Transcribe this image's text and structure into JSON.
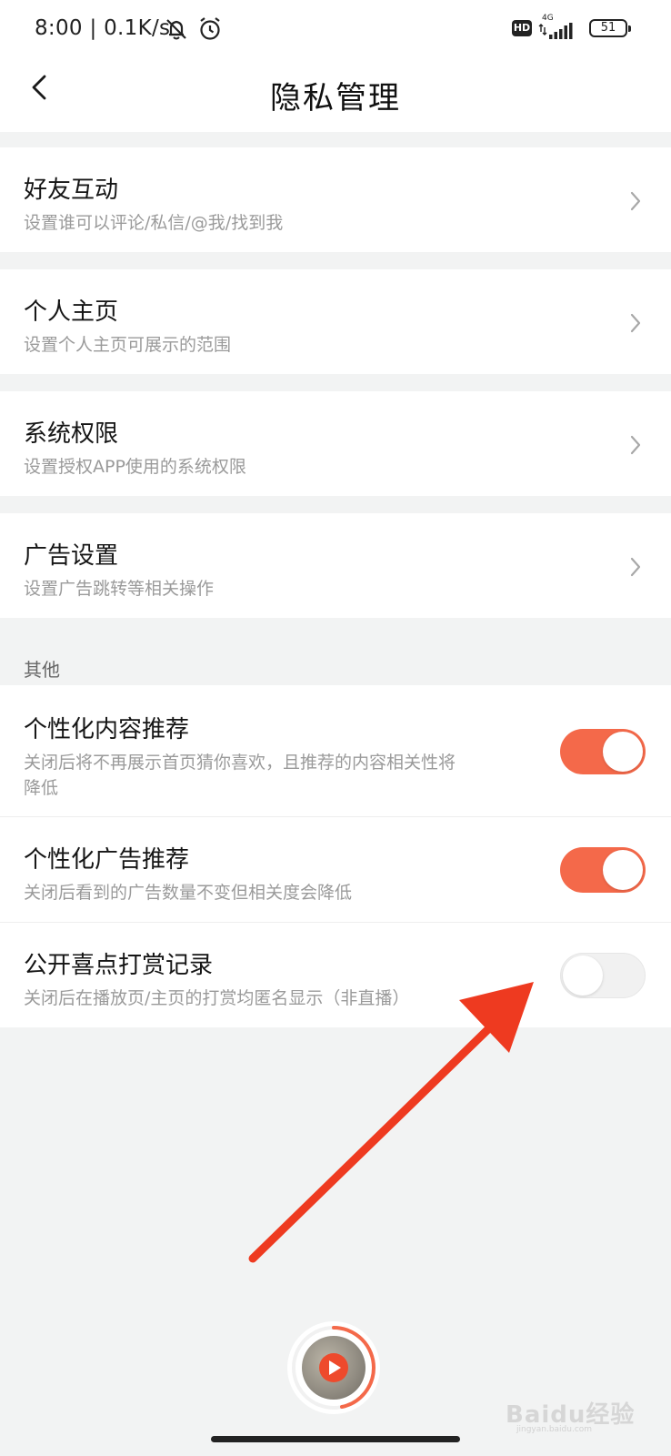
{
  "status_bar": {
    "time": "8:00 | 0.1K/s",
    "hd_label": "HD",
    "network_label": "4G",
    "battery": "51"
  },
  "header": {
    "title": "隐私管理"
  },
  "menu": [
    {
      "title": "好友互动",
      "subtitle": "设置谁可以评论/私信/@我/找到我"
    },
    {
      "title": "个人主页",
      "subtitle": "设置个人主页可展示的范围"
    },
    {
      "title": "系统权限",
      "subtitle": "设置授权APP使用的系统权限"
    },
    {
      "title": "广告设置",
      "subtitle": "设置广告跳转等相关操作"
    }
  ],
  "other_section": {
    "label": "其他",
    "items": [
      {
        "title": "个性化内容推荐",
        "subtitle_line1": "关闭后将不再展示首页猜你喜欢，且推荐的内容相关性将",
        "subtitle_line2": "降低",
        "enabled": true
      },
      {
        "title": "个性化广告推荐",
        "subtitle": "关闭后看到的广告数量不变但相关度会降低",
        "enabled": true
      },
      {
        "title": "公开喜点打赏记录",
        "subtitle": "关闭后在播放页/主页的打赏均匿名显示（非直播）",
        "enabled": false
      }
    ]
  },
  "colors": {
    "accent": "#f4694a",
    "annotation_arrow": "#ee3a20",
    "background": "#f2f3f3"
  },
  "watermark": {
    "text": "Baidu经验",
    "sub": "jingyan.baidu.com"
  }
}
